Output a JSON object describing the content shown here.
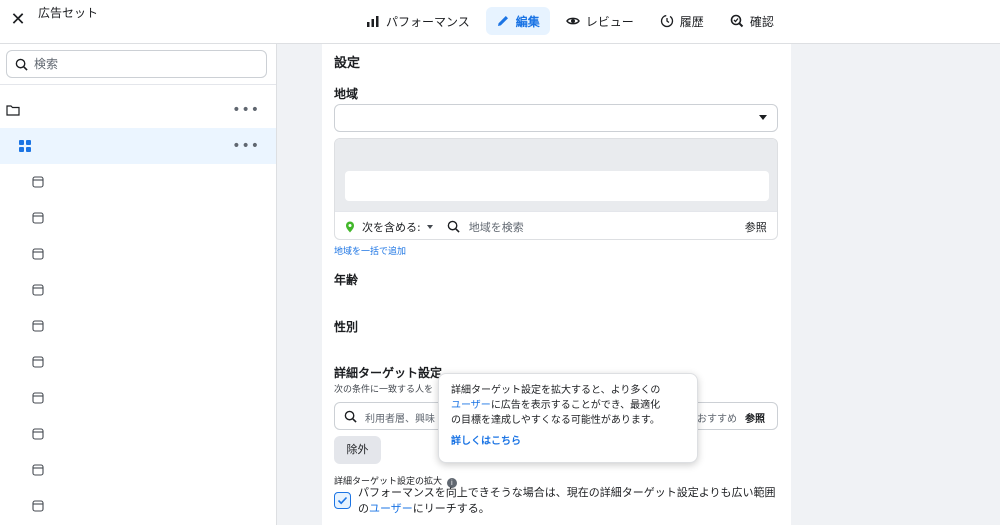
{
  "window": {
    "title": "広告セット"
  },
  "tabs": [
    {
      "label": "パフォーマンス",
      "icon": "bar-chart-icon",
      "active": false
    },
    {
      "label": "編集",
      "icon": "pencil-icon",
      "active": true
    },
    {
      "label": "レビュー",
      "icon": "eye-icon",
      "active": false
    },
    {
      "label": "履歴",
      "icon": "history-icon",
      "active": false
    },
    {
      "label": "確認",
      "icon": "magnify-check-icon",
      "active": false
    }
  ],
  "sidebar": {
    "search_placeholder": "検索",
    "more_label": "•••",
    "rows": [
      {
        "icon": "folder-icon",
        "selected": false,
        "more": true
      },
      {
        "icon": "grid-icon",
        "selected": true,
        "more": true
      },
      {
        "icon": "ad-icon",
        "selected": false,
        "more": false
      },
      {
        "icon": "ad-icon",
        "selected": false,
        "more": false
      },
      {
        "icon": "ad-icon",
        "selected": false,
        "more": false
      },
      {
        "icon": "ad-icon",
        "selected": false,
        "more": false
      },
      {
        "icon": "ad-icon",
        "selected": false,
        "more": false
      },
      {
        "icon": "ad-icon",
        "selected": false,
        "more": false
      },
      {
        "icon": "ad-icon",
        "selected": false,
        "more": false
      },
      {
        "icon": "ad-icon",
        "selected": false,
        "more": false
      },
      {
        "icon": "ad-icon",
        "selected": false,
        "more": false
      }
    ]
  },
  "settings": {
    "title": "設定",
    "location": {
      "label": "地域",
      "include_label": "次を含める:",
      "search_placeholder": "地域を検索",
      "browse": "参照",
      "bulk_add": "地域を一括で追加"
    },
    "age_label": "年齢",
    "gender_label": "性別",
    "detailed": {
      "title": "詳細ターゲット設定",
      "subtitle": "次の条件に一致する人を",
      "input_placeholder": "利用者層、興味",
      "suggestions": "おすすめ",
      "browse": "参照",
      "exclude": "除外",
      "expansion_label": "詳細ターゲット設定の拡大",
      "checkbox_text_1": "パフォーマンスを向上できそうな場合は、現在の詳細ターゲット設定よりも広い範囲の",
      "checkbox_link": "ユーザー",
      "checkbox_text_2": "にリーチする。",
      "checked": true
    }
  },
  "tooltip": {
    "line1": "詳細ターゲット設定を拡大すると、より多くの",
    "link_user": "ユーザー",
    "line2_rest": "に広告を表示することができ、最適化",
    "line3": "の目標を達成しやすくなる可能性があります。",
    "learn_more": "詳しくはこちら"
  },
  "colors": {
    "accent": "#1b74e4",
    "location_pin": "#42b72a"
  }
}
